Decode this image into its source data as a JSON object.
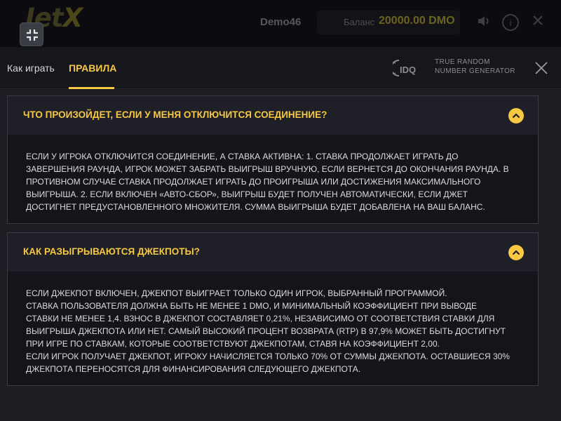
{
  "topbar": {
    "logo_main": "Jet",
    "logo_x": "X",
    "username": "Demo46",
    "balance_label": "Баланс",
    "balance_value": "20000.00 DMO",
    "icons": [
      "sound-icon",
      "info-icon",
      "close-icon"
    ]
  },
  "modal": {
    "tabs": [
      {
        "label": "Как играть",
        "active": false
      },
      {
        "label": "ПРАВИЛА",
        "active": true
      }
    ],
    "rng_logo_text": "IDQ",
    "rng_line1": "TRUE RANDOM",
    "rng_line2": "NUMBER GENERATOR"
  },
  "faq": [
    {
      "question": "ЧТО ПРОИЗОЙДЕТ, ЕСЛИ У МЕНЯ ОТКЛЮЧИТСЯ СОЕДИНЕНИЕ?",
      "answer_lines": [
        "ЕСЛИ У ИГРОКА ОТКЛЮЧИТСЯ СОЕДИНЕНИЕ, А СТАВКА АКТИВНА: 1. СТАВКА ПРОДОЛЖАЕТ ИГРАТЬ ДО",
        "ЗАВЕРШЕНИЯ РАУНДА, ИГРОК МОЖЕТ ЗАБРАТЬ ВЫИГРЫШ ВРУЧНУЮ, ЕСЛИ ВЕРНЕТСЯ ДО ОКОНЧАНИЯ РАУНДА. В",
        "ПРОТИВНОМ СЛУЧАЕ СТАВКА ПРОДОЛЖАЕТ ИГРАТЬ ДО ПРОИГРЫША ИЛИ ДОСТИЖЕНИЯ МАКСИМАЛЬНОГО",
        "ВЫИГРЫША. 2. ЕСЛИ ВКЛЮЧЕН «АВТО-СБОР», ВЫИГРЫШ БУДЕТ ПОЛУЧЕН АВТОМАТИЧЕСКИ, ЕСЛИ ДЖЕТ",
        "ДОСТИГНЕТ ПРЕДУСТАНОВЛЕННОГО МНОЖИТЕЛЯ. СУММА ВЫИГРЫША БУДЕТ ДОБАВЛЕНА НА ВАШ БАЛАНС."
      ]
    },
    {
      "question": "КАК РАЗЫГРЫВАЮТСЯ ДЖЕКПОТЫ?",
      "answer_lines": [
        "ЕСЛИ ДЖЕКПОТ ВКЛЮЧЕН, ДЖЕКПОТ ВЫИГРАЕТ ТОЛЬКО ОДИН ИГРОК, ВЫБРАННЫЙ ПРОГРАММОЙ.",
        "СТАВКА ПОЛЬЗОВАТЕЛЯ ДОЛЖНА БЫТЬ НЕ МЕНЕЕ 1 DMO, И МИНИМАЛЬНЫЙ КОЭФФИЦИЕНТ ПРИ ВЫВОДЕ",
        "СТАВКИ НЕ МЕНЕЕ 1,4. ВЗНОС В ДЖЕКПОТ СОСТАВЛЯЕТ 0,21%, НЕЗАВИСИМО ОТ СООТВЕТСТВИЯ СТАВКИ ДЛЯ",
        "ВЫИГРЫША ДЖЕКПОТА ИЛИ НЕТ. САМЫЙ ВЫСОКИЙ ПРОЦЕНТ ВОЗВРАТА (RTP) В 97,9% МОЖЕТ БЫТЬ ДОСТИГНУТ",
        "ПРИ ИГРЕ ПО СТАВКАМ, КОТОРЫЕ СООТВЕТСТВУЮТ ДЖЕКПОТАМ, СТАВЯ НА КОЭФФИЦИЕНТ 2,00.",
        "ЕСЛИ ИГРОК ПОЛУЧАЕТ ДЖЕКПОТ, ИГРОКУ НАЧИСЛЯЕТСЯ ТОЛЬКО 70% ОТ СУММЫ ДЖЕКПОТА. ОСТАВШИЕСЯ 30%",
        "ДЖЕКПОТА ПЕРЕНОСЯТСЯ ДЛЯ ФИНАНСИРОВАНИЯ СЛЕДУЮЩЕГО ДЖЕКПОТА."
      ]
    }
  ],
  "colors": {
    "accent": "#f6c844",
    "panel": "#14141b",
    "header": "#1e1f27",
    "background": "#1d1d24"
  }
}
